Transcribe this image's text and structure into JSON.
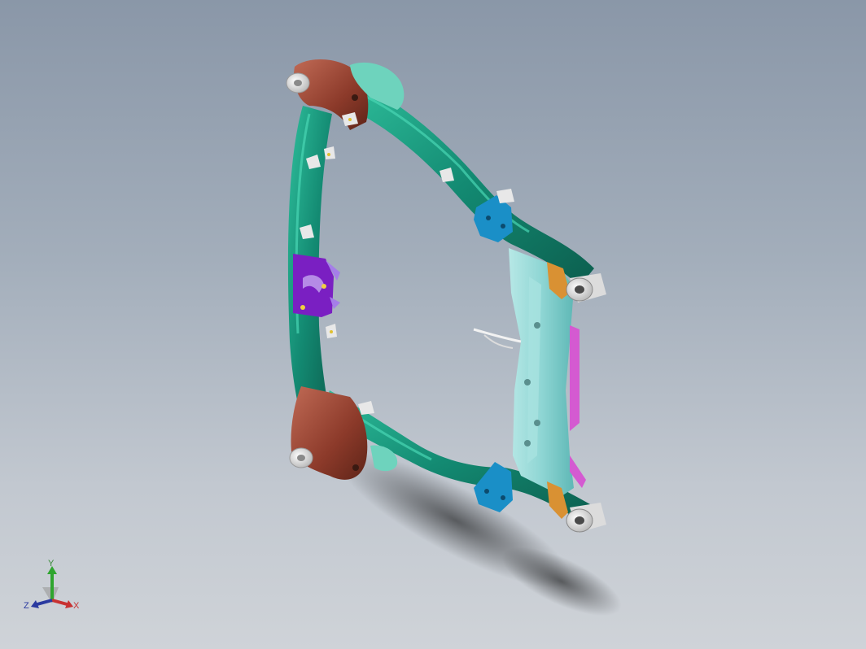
{
  "scene": {
    "model": "subframe-assembly",
    "part_colors": {
      "frame": "#138a72",
      "frame_highlight": "#3fc7a8",
      "bushing_bracket": "#8c3a2a",
      "mount_plate": "#6ed3bd",
      "crossmember": "#8fd6d4",
      "blue_bracket": "#1a8fc7",
      "orange_tab": "#d99133",
      "purple_bracket": "#7a1fc2",
      "pink_plate": "#d45ad1",
      "bushing": "#e8e8e8"
    }
  },
  "triad": {
    "x_label": "X",
    "y_label": "Y",
    "z_label": "Z",
    "x_color": "#c83232",
    "y_color": "#2fa52f",
    "z_color": "#2a3aa0"
  }
}
